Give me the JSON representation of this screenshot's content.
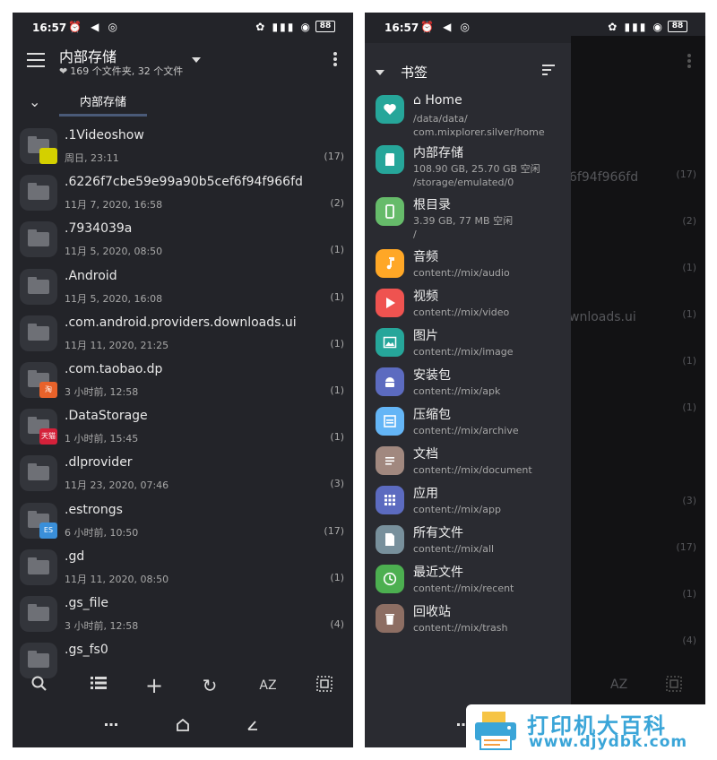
{
  "status_bar": {
    "time": "16:57",
    "battery": "88"
  },
  "left_panel": {
    "title": "内部存储",
    "subtitle": "169 个文件夹, 32 个文件",
    "breadcrumb_tab": "内部存储",
    "files": [
      {
        "name": ".1Videoshow",
        "date": "周日, 23:11",
        "count": "(17)",
        "badge": "yellow"
      },
      {
        "name": ".6226f7cbe59e99a90b5cef6f94f966fd",
        "date": "11月 7, 2020, 16:58",
        "count": "(2)"
      },
      {
        "name": ".7934039a",
        "date": "11月 5, 2020, 08:50",
        "count": "(1)"
      },
      {
        "name": ".Android",
        "date": "11月 5, 2020, 16:08",
        "count": "(1)"
      },
      {
        "name": ".com.android.providers.downloads.ui",
        "date": "11月 11, 2020, 21:25",
        "count": "(1)"
      },
      {
        "name": ".com.taobao.dp",
        "date": "3 小时前, 12:58",
        "count": "(1)",
        "badge": "taobao",
        "badge_label": "淘"
      },
      {
        "name": ".DataStorage",
        "date": "1 小时前, 15:45",
        "count": "(1)",
        "badge": "tmall",
        "badge_label": "天猫"
      },
      {
        "name": ".dlprovider",
        "date": "11月 23, 2020, 07:46",
        "count": "(3)"
      },
      {
        "name": ".estrongs",
        "date": "6 小时前, 10:50",
        "count": "(17)",
        "badge": "es",
        "badge_label": "ES"
      },
      {
        "name": ".gd",
        "date": "11月 11, 2020, 08:50",
        "count": "(1)"
      },
      {
        "name": ".gs_file",
        "date": "3 小时前, 12:58",
        "count": "(4)"
      },
      {
        "name": ".gs_fs0",
        "date": "",
        "count": ""
      }
    ],
    "toolbar": {
      "sort_label": "AZ"
    }
  },
  "right_panel": {
    "title": "书签",
    "bookmarks": [
      {
        "name": "⌂ Home",
        "path": "/data/data/\ncom.mixplorer.silver/home",
        "color": "#26a69a",
        "icon": "heart-icon"
      },
      {
        "name": "内部存储",
        "path": "108.90 GB, 25.70 GB 空闲\n/storage/emulated/0",
        "color": "#26a69a",
        "icon": "sd-card-icon"
      },
      {
        "name": "根目录",
        "path": "3.39 GB, 77 MB 空闲\n/",
        "color": "#66bb6a",
        "icon": "phone-icon"
      },
      {
        "name": "音频",
        "path": "content://mix/audio",
        "color": "#ffa726",
        "icon": "music-icon"
      },
      {
        "name": "视频",
        "path": "content://mix/video",
        "color": "#ef5350",
        "icon": "play-icon"
      },
      {
        "name": "图片",
        "path": "content://mix/image",
        "color": "#26a69a",
        "icon": "image-icon"
      },
      {
        "name": "安装包",
        "path": "content://mix/apk",
        "color": "#5c6bc0",
        "icon": "android-icon"
      },
      {
        "name": "压缩包",
        "path": "content://mix/archive",
        "color": "#64b5f6",
        "icon": "archive-icon"
      },
      {
        "name": "文档",
        "path": "content://mix/document",
        "color": "#a1887f",
        "icon": "document-icon"
      },
      {
        "name": "应用",
        "path": "content://mix/app",
        "color": "#5c6bc0",
        "icon": "grid-icon"
      },
      {
        "name": "所有文件",
        "path": "content://mix/all",
        "color": "#78909c",
        "icon": "file-icon"
      },
      {
        "name": "最近文件",
        "path": "content://mix/recent",
        "color": "#4caf50",
        "icon": "clock-icon"
      },
      {
        "name": "回收站",
        "path": "content://mix/trash",
        "color": "#8d6e63",
        "icon": "trash-icon"
      }
    ],
    "dimmed": {
      "fragment_1": "6f94f966fd",
      "fragment_2": "wnloads.ui",
      "sort_label": "AZ",
      "counts": [
        "(17)",
        "(2)",
        "(1)",
        "(1)",
        "(1)",
        "(1)",
        "(3)",
        "(17)",
        "(1)",
        "(4)"
      ]
    }
  },
  "watermark": {
    "title": "打印机大百科",
    "url": "www.djydbk.com"
  }
}
